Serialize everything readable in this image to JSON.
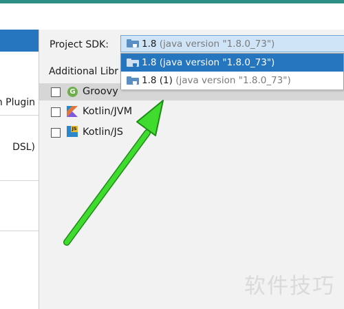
{
  "sidebar": {
    "items": [
      {
        "label": "n Plugin"
      },
      {
        "label": "DSL)"
      }
    ]
  },
  "sdk": {
    "label": "Project SDK:",
    "selected_version": "1.8",
    "selected_detail": "(java version \"1.8.0_73\")"
  },
  "dropdown": {
    "options": [
      {
        "version": "1.8",
        "detail": "(java version \"1.8.0_73\")"
      },
      {
        "version": "1.8 (1)",
        "detail": "(java version \"1.8.0_73\")"
      }
    ]
  },
  "libraries": {
    "label": "Additional Libr",
    "items": [
      {
        "name": "Groovy",
        "icon": "groovy-icon",
        "checked": false
      },
      {
        "name": "Kotlin/JVM",
        "icon": "kotlin-icon",
        "checked": false
      },
      {
        "name": "Kotlin/JS",
        "icon": "kotlin-js-icon",
        "checked": false
      }
    ]
  },
  "watermark": "软件技巧",
  "colors": {
    "accent": "#2675bf",
    "top_strip": "#2f8f86",
    "annotation_arrow": "#3fdc2f"
  }
}
